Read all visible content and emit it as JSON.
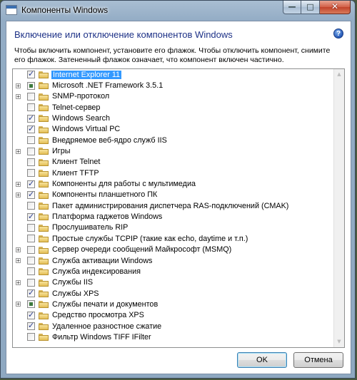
{
  "window": {
    "title": "Компоненты Windows",
    "caption": {
      "minimize": "—",
      "maximize": "□",
      "close": "✕"
    }
  },
  "heading": "Включение или отключение компонентов Windows",
  "help": "?",
  "description": "Чтобы включить компонент, установите его флажок. Чтобы отключить компонент, снимите его флажок. Затененный флажок означает, что компонент включен частично.",
  "features": [
    {
      "label": "Internet Explorer 11",
      "state": "checked",
      "expandable": false,
      "selected": true
    },
    {
      "label": "Microsoft .NET Framework 3.5.1",
      "state": "partial",
      "expandable": true
    },
    {
      "label": "SNMP-протокол",
      "state": "unchecked",
      "expandable": true
    },
    {
      "label": "Telnet-сервер",
      "state": "unchecked",
      "expandable": false
    },
    {
      "label": "Windows Search",
      "state": "checked",
      "expandable": false
    },
    {
      "label": "Windows Virtual PC",
      "state": "checked",
      "expandable": false
    },
    {
      "label": "Внедряемое веб-ядро служб IIS",
      "state": "unchecked",
      "expandable": false
    },
    {
      "label": "Игры",
      "state": "unchecked",
      "expandable": true
    },
    {
      "label": "Клиент Telnet",
      "state": "unchecked",
      "expandable": false
    },
    {
      "label": "Клиент TFTP",
      "state": "unchecked",
      "expandable": false
    },
    {
      "label": "Компоненты для работы с мультимедиа",
      "state": "checked",
      "expandable": true
    },
    {
      "label": "Компоненты планшетного ПК",
      "state": "checked",
      "expandable": true
    },
    {
      "label": "Пакет администрирования диспетчера RAS-подключений (CMAK)",
      "state": "unchecked",
      "expandable": false
    },
    {
      "label": "Платформа гаджетов Windows",
      "state": "checked",
      "expandable": false
    },
    {
      "label": "Прослушиватель RIP",
      "state": "unchecked",
      "expandable": false
    },
    {
      "label": "Простые службы TCPIP (такие как echo, daytime и т.п.)",
      "state": "unchecked",
      "expandable": false
    },
    {
      "label": "Сервер очереди сообщений Майкрософт (MSMQ)",
      "state": "unchecked",
      "expandable": true
    },
    {
      "label": "Служба активации Windows",
      "state": "unchecked",
      "expandable": true
    },
    {
      "label": "Служба индексирования",
      "state": "unchecked",
      "expandable": false
    },
    {
      "label": "Службы IIS",
      "state": "unchecked",
      "expandable": true
    },
    {
      "label": "Службы XPS",
      "state": "checked",
      "expandable": false
    },
    {
      "label": "Службы печати и документов",
      "state": "partial",
      "expandable": true
    },
    {
      "label": "Средство просмотра XPS",
      "state": "checked",
      "expandable": false
    },
    {
      "label": "Удаленное разностное сжатие",
      "state": "checked",
      "expandable": false
    },
    {
      "label": "Фильтр Windows TIFF IFilter",
      "state": "unchecked",
      "expandable": false
    }
  ],
  "scrollbar": {
    "up": "▲",
    "down": "▼"
  },
  "buttons": {
    "ok": "OK",
    "cancel": "Отмена"
  }
}
